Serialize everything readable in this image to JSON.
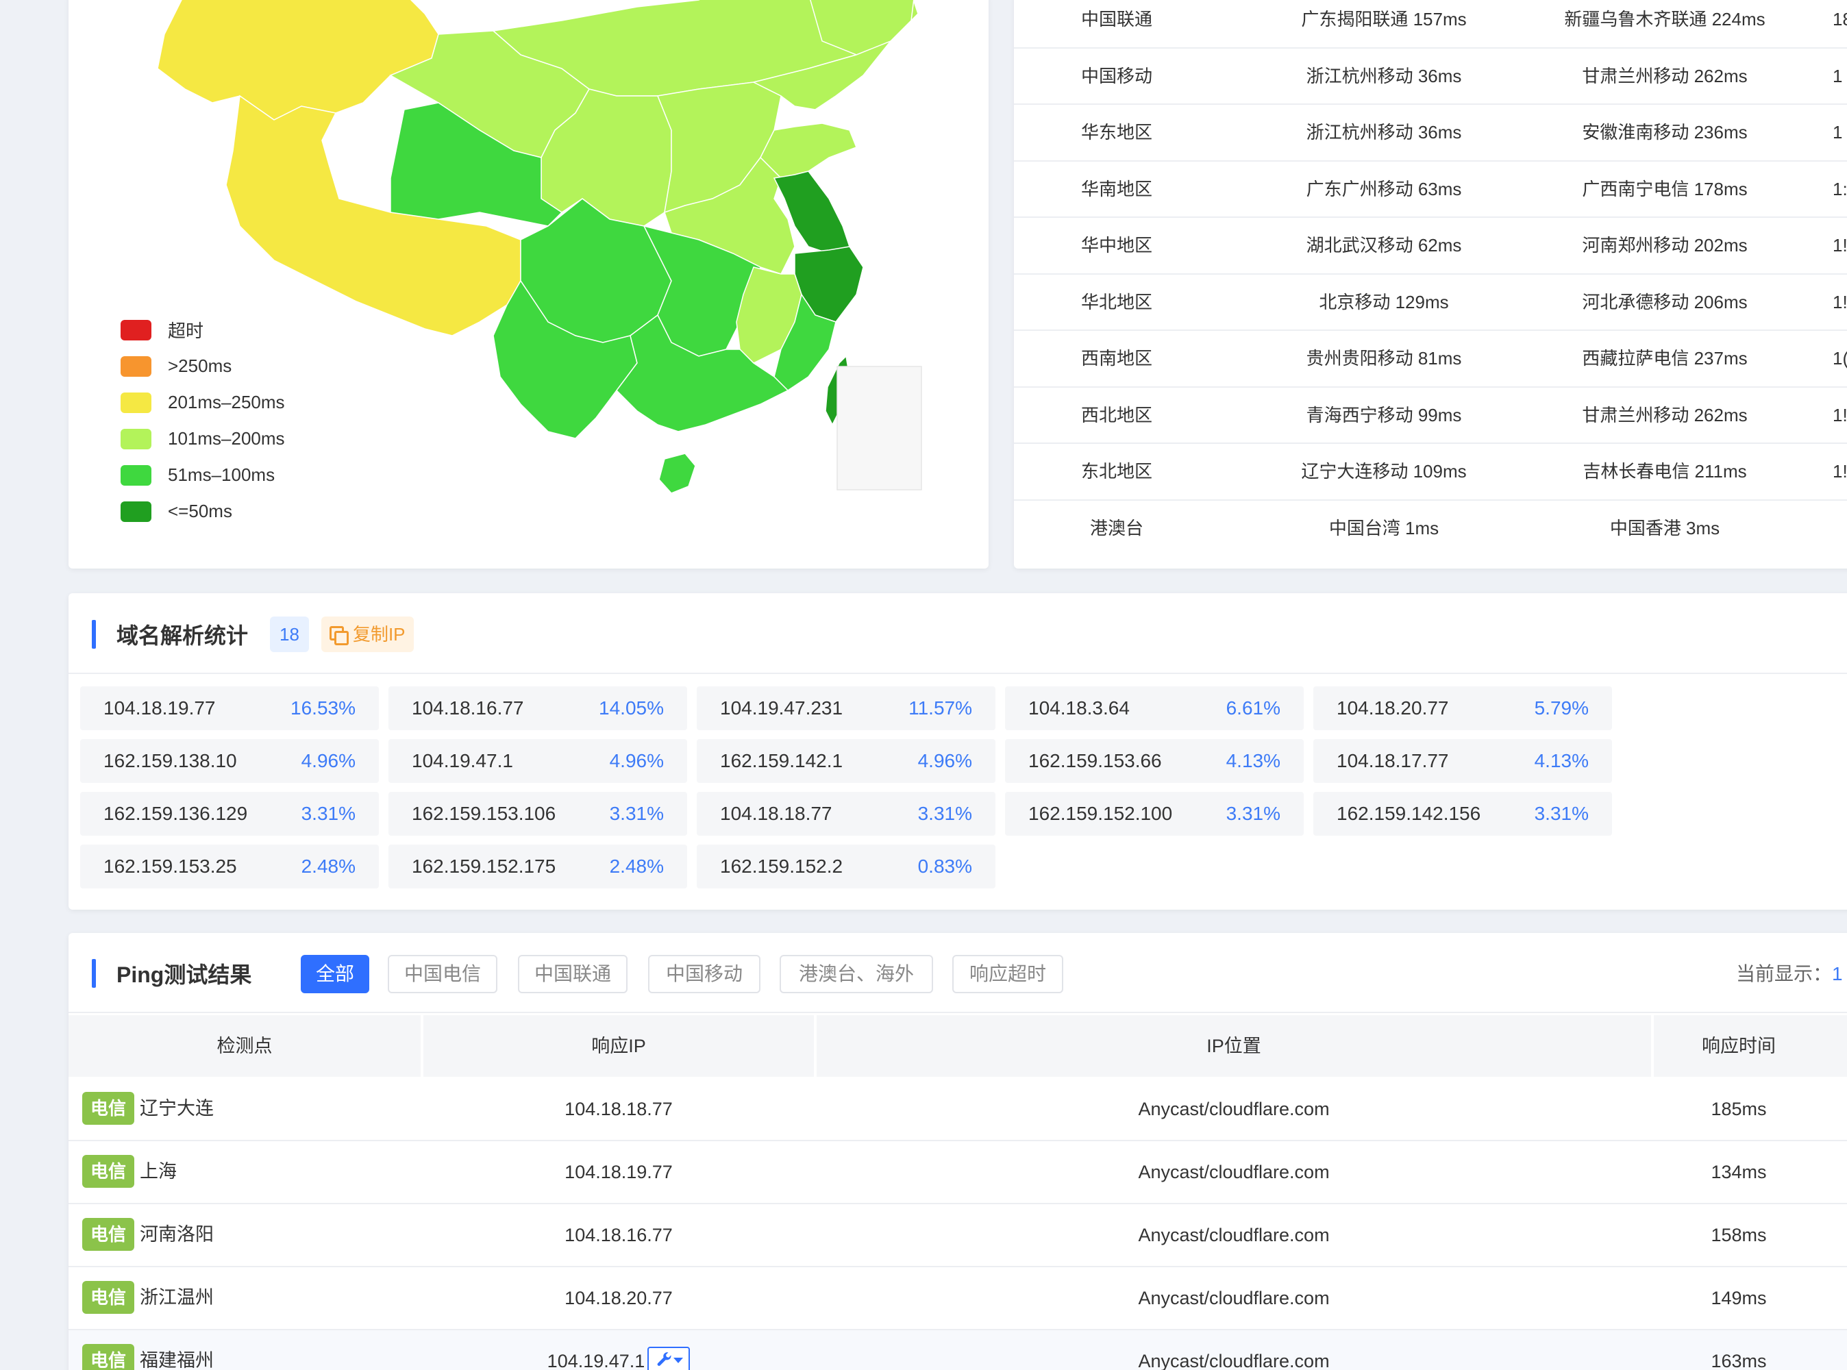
{
  "legend": [
    {
      "label": "超时",
      "color": "#e02020"
    },
    {
      "label": ">250ms",
      "color": "#f7952e"
    },
    {
      "label": "201ms–250ms",
      "color": "#f5e843"
    },
    {
      "label": "101ms–200ms",
      "color": "#b3f35a"
    },
    {
      "label": "51ms–100ms",
      "color": "#3fd83f"
    },
    {
      "label": "<=50ms",
      "color": "#209f20"
    }
  ],
  "region_rows": [
    {
      "region": "中国联通",
      "fastest": "广东揭阳联通 157ms",
      "slowest": "新疆乌鲁木齐联通 224ms",
      "avg": "18"
    },
    {
      "region": "中国移动",
      "fastest": "浙江杭州移动 36ms",
      "slowest": "甘肃兰州移动 262ms",
      "avg": "1"
    },
    {
      "region": "华东地区",
      "fastest": "浙江杭州移动 36ms",
      "slowest": "安徽淮南移动 236ms",
      "avg": "1"
    },
    {
      "region": "华南地区",
      "fastest": "广东广州移动 63ms",
      "slowest": "广西南宁电信 178ms",
      "avg": "1:"
    },
    {
      "region": "华中地区",
      "fastest": "湖北武汉移动 62ms",
      "slowest": "河南郑州移动 202ms",
      "avg": "1!"
    },
    {
      "region": "华北地区",
      "fastest": "北京移动 129ms",
      "slowest": "河北承德移动 206ms",
      "avg": "1!"
    },
    {
      "region": "西南地区",
      "fastest": "贵州贵阳移动 81ms",
      "slowest": "西藏拉萨电信 237ms",
      "avg": "1("
    },
    {
      "region": "西北地区",
      "fastest": "青海西宁移动 99ms",
      "slowest": "甘肃兰州移动 262ms",
      "avg": "1!"
    },
    {
      "region": "东北地区",
      "fastest": "辽宁大连移动 109ms",
      "slowest": "吉林长春电信 211ms",
      "avg": "1!"
    },
    {
      "region": "港澳台",
      "fastest": "中国台湾 1ms",
      "slowest": "中国香港 3ms",
      "avg": ""
    }
  ],
  "dns": {
    "title": "域名解析统计",
    "count": "18",
    "copy_label": "复制IP",
    "ips": [
      {
        "ip": "104.18.19.77",
        "pct": "16.53%"
      },
      {
        "ip": "104.18.16.77",
        "pct": "14.05%"
      },
      {
        "ip": "104.19.47.231",
        "pct": "11.57%"
      },
      {
        "ip": "104.18.3.64",
        "pct": "6.61%"
      },
      {
        "ip": "104.18.20.77",
        "pct": "5.79%"
      },
      {
        "ip": "162.159.138.10",
        "pct": "4.96%"
      },
      {
        "ip": "104.19.47.1",
        "pct": "4.96%"
      },
      {
        "ip": "162.159.142.1",
        "pct": "4.96%"
      },
      {
        "ip": "162.159.153.66",
        "pct": "4.13%"
      },
      {
        "ip": "104.18.17.77",
        "pct": "4.13%"
      },
      {
        "ip": "162.159.136.129",
        "pct": "3.31%"
      },
      {
        "ip": "162.159.153.106",
        "pct": "3.31%"
      },
      {
        "ip": "104.18.18.77",
        "pct": "3.31%"
      },
      {
        "ip": "162.159.152.100",
        "pct": "3.31%"
      },
      {
        "ip": "162.159.142.156",
        "pct": "3.31%"
      },
      {
        "ip": "162.159.153.25",
        "pct": "2.48%"
      },
      {
        "ip": "162.159.152.175",
        "pct": "2.48%"
      },
      {
        "ip": "162.159.152.2",
        "pct": "0.83%"
      }
    ]
  },
  "ping": {
    "title": "Ping测试结果",
    "tabs": [
      "全部",
      "中国电信",
      "中国联通",
      "中国移动",
      "港澳台、海外",
      "响应超时"
    ],
    "active_tab": 0,
    "showing_label": "当前显示：",
    "showing_value": "1",
    "headers": [
      "检测点",
      "响应IP",
      "IP位置",
      "响应时间"
    ],
    "rows": [
      {
        "isp": "电信",
        "location": "辽宁大连",
        "ip": "104.18.18.77",
        "geo": "Anycast/cloudflare.com",
        "time": "185ms"
      },
      {
        "isp": "电信",
        "location": "上海",
        "ip": "104.18.19.77",
        "geo": "Anycast/cloudflare.com",
        "time": "134ms"
      },
      {
        "isp": "电信",
        "location": "河南洛阳",
        "ip": "104.18.16.77",
        "geo": "Anycast/cloudflare.com",
        "time": "158ms"
      },
      {
        "isp": "电信",
        "location": "浙江温州",
        "ip": "104.18.20.77",
        "geo": "Anycast/cloudflare.com",
        "time": "149ms"
      },
      {
        "isp": "电信",
        "location": "福建福州",
        "ip": "104.19.47.1",
        "geo": "Anycast/cloudflare.com",
        "time": "163ms"
      }
    ]
  }
}
